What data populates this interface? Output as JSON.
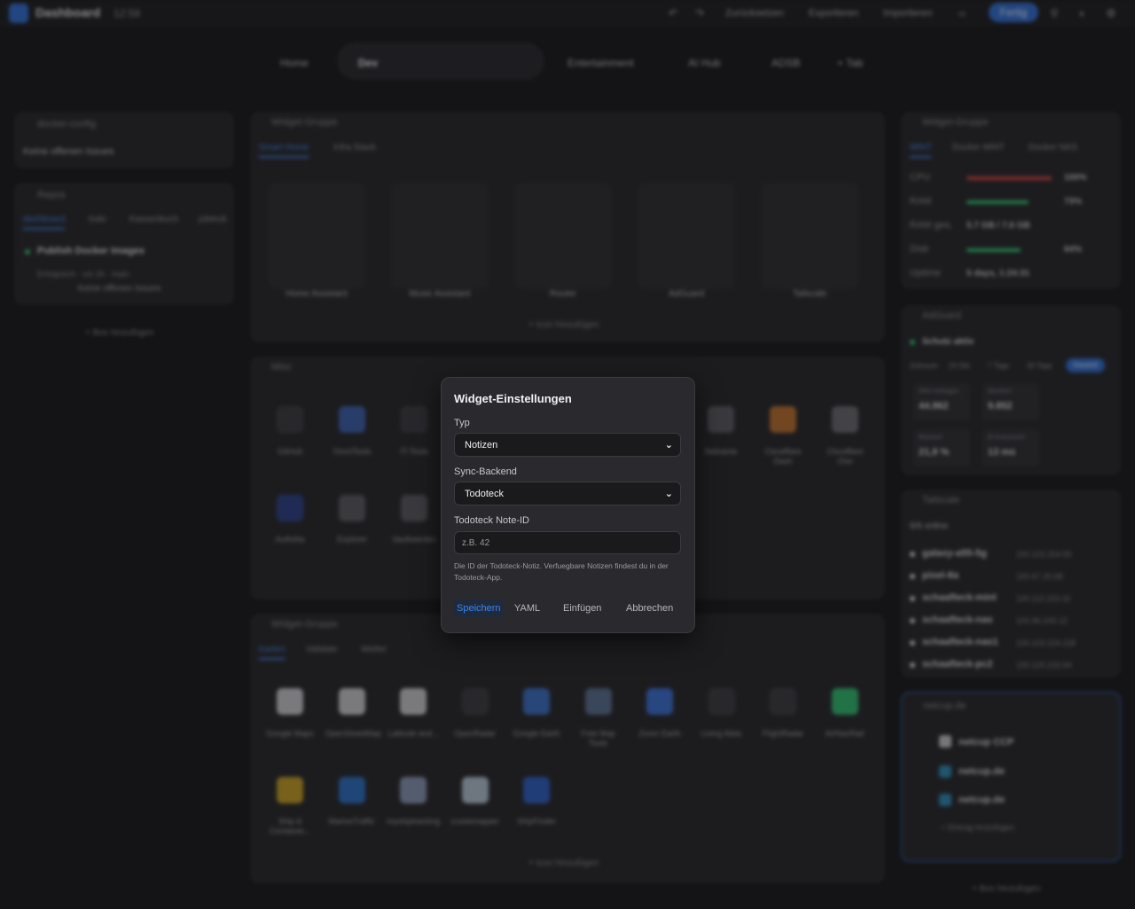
{
  "topbar": {
    "title": "Dashboard",
    "clock": "12:58",
    "reset_label": "Zurücksetzen",
    "export_label": "Exportieren",
    "import_label": "Importieren",
    "done_label": "Fertig"
  },
  "tabs": [
    "Home",
    "Dev",
    "Entertainment",
    "AI Hub",
    "ADSB",
    "+ Tab"
  ],
  "left": {
    "docker_title": "docker-config",
    "docker_text": "Keine offenen Issues",
    "repos_title": "Repos",
    "repos_tabs": [
      "dashboard",
      "todo",
      "Kassenbuch",
      "jobteck"
    ],
    "workflow_name": "Publish Docker Images",
    "workflow_meta": "Erfolgreich · vor 2h · main",
    "workflow_issues": "Keine offenen Issues",
    "add_box": "+ Box hinzufügen"
  },
  "center": {
    "group1_title": "Widget-Gruppe",
    "group1_tabs": [
      "Smart Home",
      "Infra Stack"
    ],
    "group1_tiles": [
      "Home Assistant",
      "Music Assistant",
      "Router",
      "AdGuard",
      "Tailscale"
    ],
    "add_icon": "+ Icon hinzufügen",
    "misc_title": "Misc",
    "misc_row1": [
      "GitHub",
      "OmniTools",
      "IT-Tools",
      "Netname",
      "Cloudflare Dash",
      "Cloudflare One"
    ],
    "misc_row2": [
      "Authelia",
      "Explorer",
      "Vaultwarden"
    ],
    "group3_title": "Widget-Gruppe",
    "group3_tabs": [
      "Karten",
      "Validate",
      "Wetter"
    ],
    "group3_row1": [
      "Google Maps",
      "OpenStreetMap",
      "Latitude and...",
      "OpenRadar",
      "Google Earth",
      "Free Map Tools",
      "Zoom Earth",
      "Living Atlas",
      "FlightRadar",
      "AirNavRad"
    ],
    "group3_row2": [
      "Ship & Container...",
      "MarineTraffic",
      "myshiptracking",
      "cruisemapper",
      "ShipFinder"
    ]
  },
  "right": {
    "group_title": "Widget-Gruppe",
    "group_tabs": [
      "MINT",
      "Docker MINT",
      "Docker NAS"
    ],
    "stats": [
      {
        "label": "CPU",
        "value": "100%"
      },
      {
        "label": "RAM",
        "value": "73%"
      },
      {
        "label": "RAM ges.",
        "value": "5.7 GB / 7.6 GB"
      },
      {
        "label": "Disk",
        "value": "64%"
      },
      {
        "label": "Uptime",
        "value": "5 days, 1:24:31"
      }
    ],
    "stat_fills": [
      1.0,
      0.73,
      0.75,
      0.64
    ],
    "adguard_title": "AdGuard",
    "adguard_status": "Schutz aktiv",
    "adguard_ranges": [
      "Zeitraum",
      "24 Std.",
      "7 Tage",
      "30 Tage",
      "Gesamt"
    ],
    "adguard_cards": [
      {
        "label": "DNS-Anfragen",
        "value": "44.962"
      },
      {
        "label": "Blockiert",
        "value": "9.852"
      },
      {
        "label": "Blockiert",
        "value": "21,9 %"
      },
      {
        "label": "Ø Antwortzeit",
        "value": "13 ms"
      }
    ],
    "tailscale_title": "Tailscale",
    "tailscale_online": "6/6 online",
    "tailscale_nodes": [
      {
        "name": "galaxy-a55-5g",
        "ip": "100.122.254.55"
      },
      {
        "name": "pixel-8a",
        "ip": "100.67.25.68"
      },
      {
        "name": "schaafteck-mint",
        "ip": "100.110.223.31"
      },
      {
        "name": "schaafteck-nas",
        "ip": "100.96.249.12"
      },
      {
        "name": "schaafteck-nas1",
        "ip": "100.103.224.118"
      },
      {
        "name": "schaafteck-pc2",
        "ip": "100.120.233.94"
      }
    ],
    "netcup_title": "netcup.de",
    "netcup_items": [
      "netcup CCP",
      "netcup.de",
      "netcup.de"
    ],
    "netcup_add": "+ Eintrag hinzufügen",
    "add_box": "+ Box hinzufügen"
  },
  "modal": {
    "title": "Widget-Einstellungen",
    "type_label": "Typ",
    "type_value": "Notizen",
    "backend_label": "Sync-Backend",
    "backend_value": "Todoteck",
    "noteid_label": "Todoteck Note-ID",
    "noteid_placeholder": "z.B. 42",
    "help_text": "Die ID der Todoteck-Notiz. Verfuegbare Notizen findest du in der Todoteck-App.",
    "save_label": "Speichern",
    "yaml_label": "YAML",
    "insert_label": "Einfügen",
    "cancel_label": "Abbrechen"
  },
  "colors": {
    "accent": "#3d86f0",
    "bg": "#141416",
    "panel": "#242428",
    "status_green": "#2ecc71",
    "cpu_red": "#e0413a"
  }
}
